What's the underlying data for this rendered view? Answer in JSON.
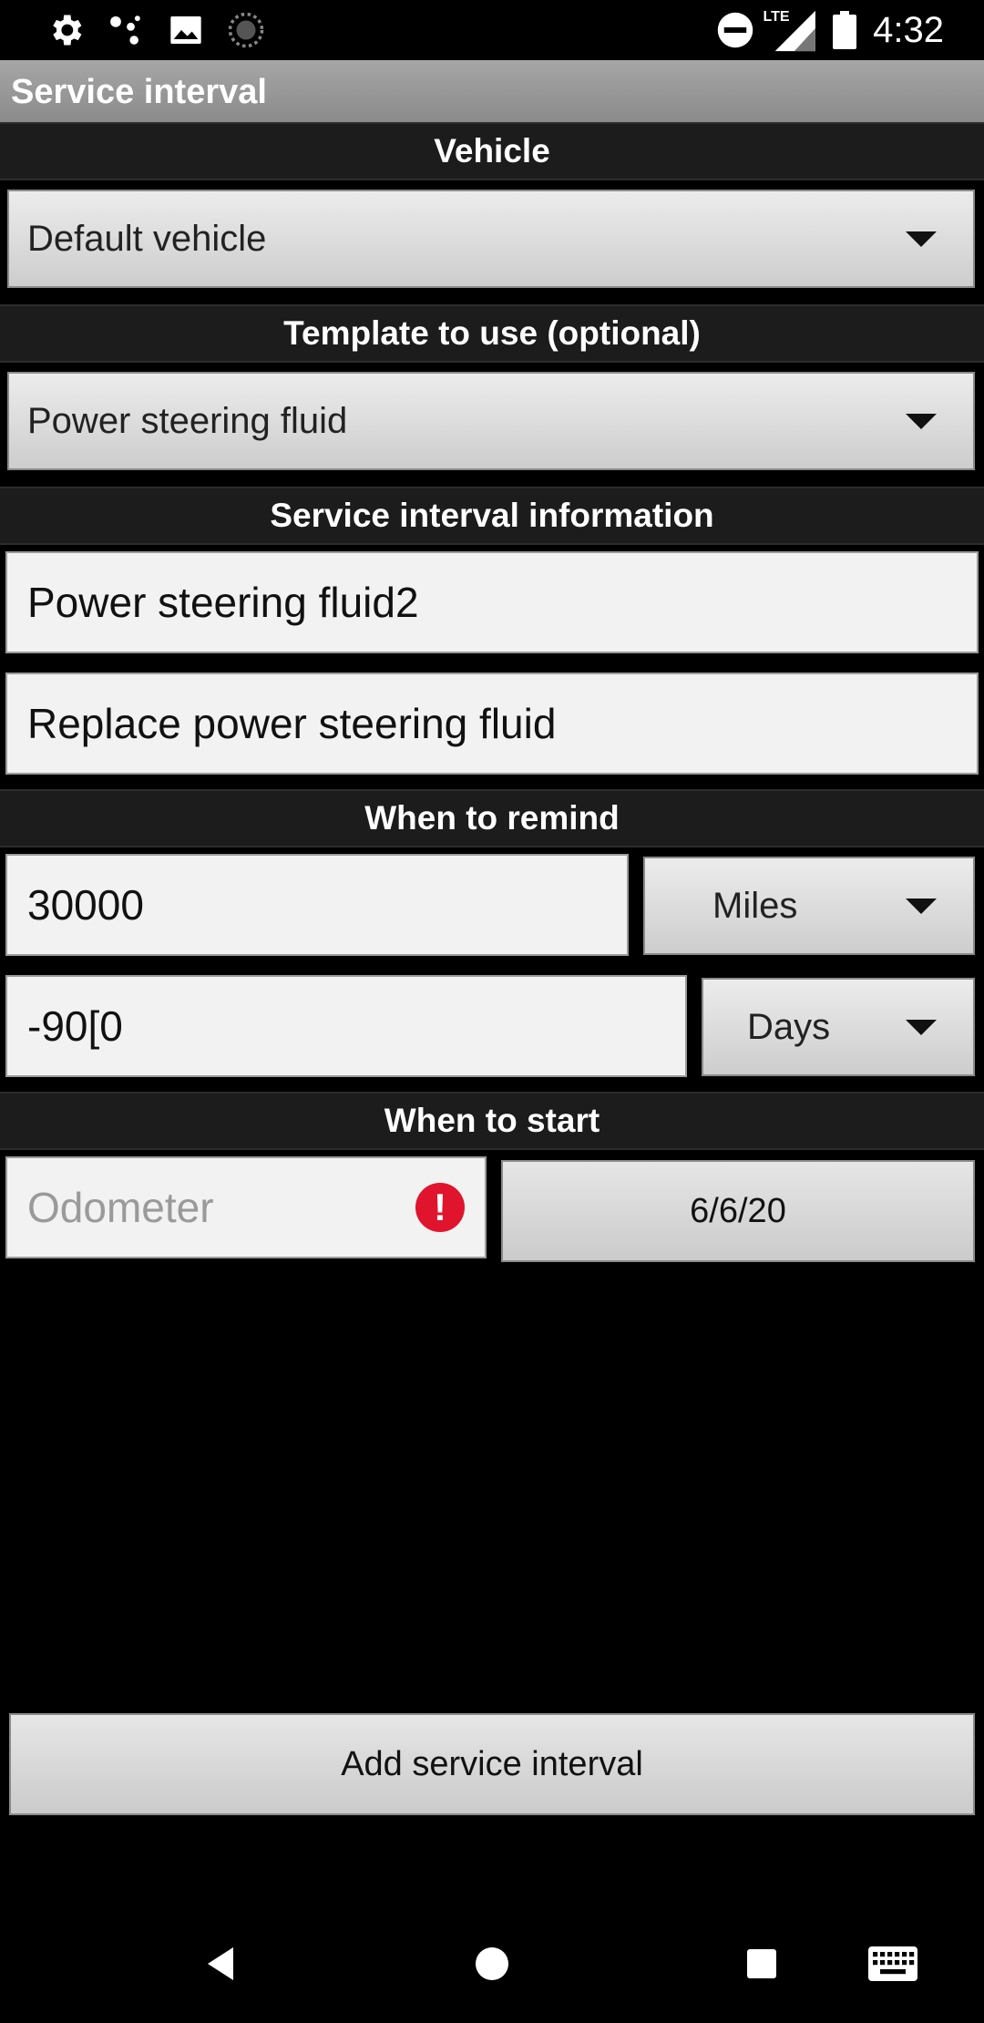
{
  "status_bar": {
    "time": "4:32",
    "network_label": "LTE",
    "icons": [
      "settings-icon",
      "assistant-dots-icon",
      "image-icon",
      "sync-spinner-icon",
      "do-not-disturb-icon",
      "signal-icon",
      "battery-icon"
    ]
  },
  "app_bar": {
    "title": "Service interval"
  },
  "sections": {
    "vehicle": "Vehicle",
    "template": "Template to use (optional)",
    "info": "Service interval information",
    "remind": "When to remind",
    "start": "When to start"
  },
  "vehicle_select": {
    "value": "Default vehicle"
  },
  "template_select": {
    "value": "Power steering fluid"
  },
  "info": {
    "name_value": "Power steering fluid2",
    "description_value": "Replace power steering fluid"
  },
  "remind": {
    "distance_value": "30000",
    "distance_unit": "Miles",
    "time_value": "-90[0",
    "time_unit": "Days"
  },
  "start": {
    "odometer_placeholder": "Odometer",
    "error_glyph": "!",
    "date_value": "6/6/20"
  },
  "actions": {
    "add_label": "Add service interval"
  },
  "nav_bar": {
    "icons": [
      "back-icon",
      "home-icon",
      "recents-icon",
      "keyboard-icon"
    ]
  },
  "colors": {
    "app_bar": "#999999",
    "section_header": "#1c1c1c",
    "error": "#e0142c",
    "background": "#000000"
  }
}
